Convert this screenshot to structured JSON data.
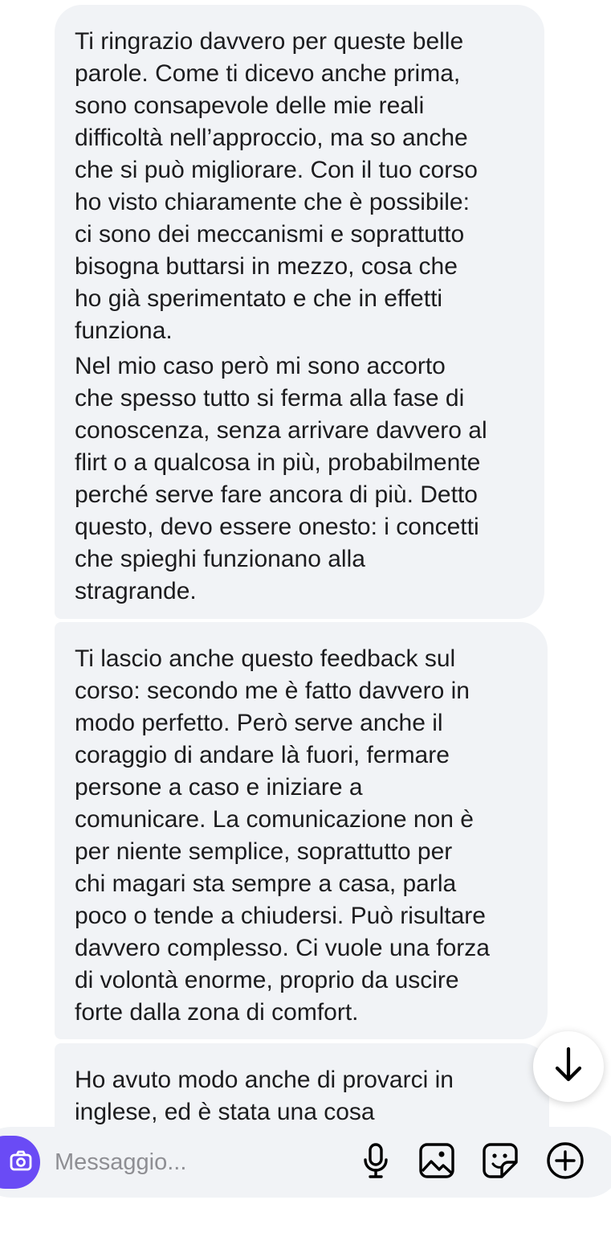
{
  "messages": [
    {
      "paragraphs": [
        "Ti ringrazio davvero per queste belle\nparole. Come ti dicevo anche prima,\nsono consapevole delle mie reali\ndifficoltà nell’approccio, ma so anche\nche si può migliorare. Con il tuo corso\nho visto chiaramente che è possibile:\nci sono dei meccanismi e soprattutto\nbisogna buttarsi in mezzo, cosa che\nho già sperimentato e che in effetti\nfunziona.",
        "Nel mio caso però mi sono accorto\nche spesso tutto si ferma alla fase di\nconoscenza, senza arrivare davvero al\nflirt o a qualcosa in più, probabilmente\nperché serve fare ancora di più. Detto\nquesto, devo essere onesto: i concetti\nche spieghi funzionano alla\nstragrande."
      ]
    },
    {
      "paragraphs": [
        "Ti lascio anche questo feedback sul\ncorso: secondo me è fatto davvero in\nmodo perfetto. Però serve anche il\ncoraggio di andare là fuori, fermare\npersone a caso e iniziare a\ncomunicare. La comunicazione non è\nper niente semplice, soprattutto per\nchi magari sta sempre a casa, parla\npoco o tende a chiudersi. Può risultare\ndavvero complesso. Ci vuole una forza\ndi volontà enorme, proprio da uscire\nforte dalla zona di comfort."
      ]
    },
    {
      "paragraphs": [
        "Ho avuto modo anche di provarci in\ninglese, ed è stata una cosa"
      ]
    }
  ],
  "composer": {
    "placeholder": "Messaggio...",
    "value": ""
  },
  "icons": {
    "camera": "camera-icon",
    "scroll_down": "arrow-down-icon",
    "microphone": "microphone-icon",
    "gallery": "gallery-icon",
    "sticker": "sticker-icon",
    "add": "plus-circle-icon"
  },
  "colors": {
    "bubble": "#f1f3f6",
    "text": "#1c1c1e",
    "camera_button": "#6a4bf5",
    "placeholder": "#8e8e93"
  }
}
